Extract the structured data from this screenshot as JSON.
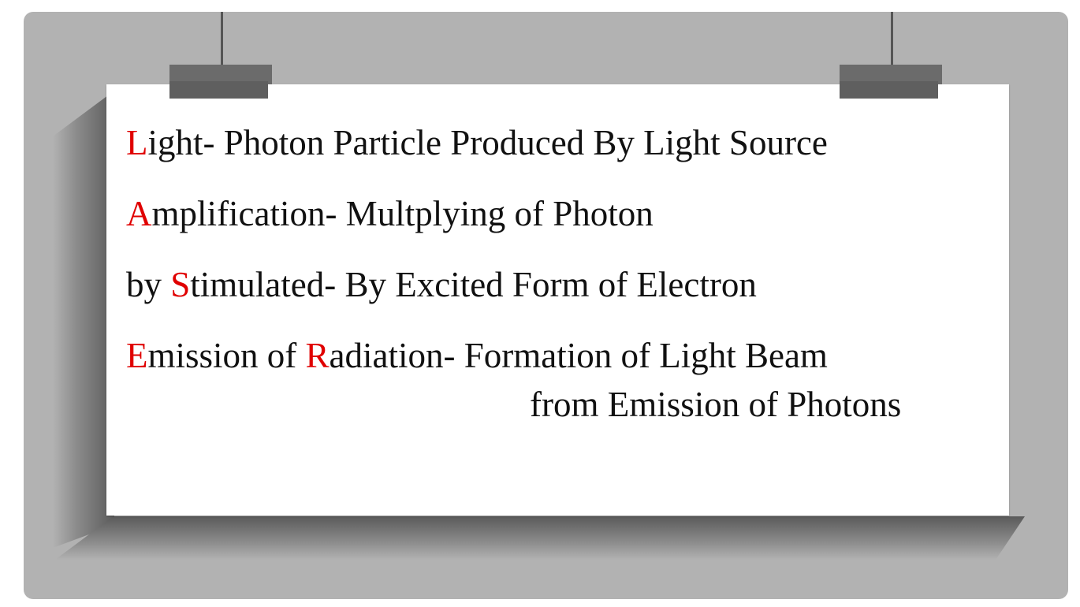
{
  "lines": [
    {
      "initial": "L",
      "rest": "ight- Photon Particle Produced By Light Source"
    },
    {
      "initial": "A",
      "rest": "mplification- Multplying of Photon"
    },
    {
      "prefix": "by ",
      "initial": "S",
      "rest": "timulated- By Excited Form of Electron"
    },
    {
      "initial": "E",
      "middle": "mission of ",
      "initial2": "R",
      "rest": "adiation- Formation of Light Beam"
    },
    {
      "continuation": "from Emission of Photons"
    }
  ],
  "colors": {
    "accent": "#e00000",
    "text": "#111111",
    "background": "#b2b2b2",
    "paper": "#ffffff"
  }
}
